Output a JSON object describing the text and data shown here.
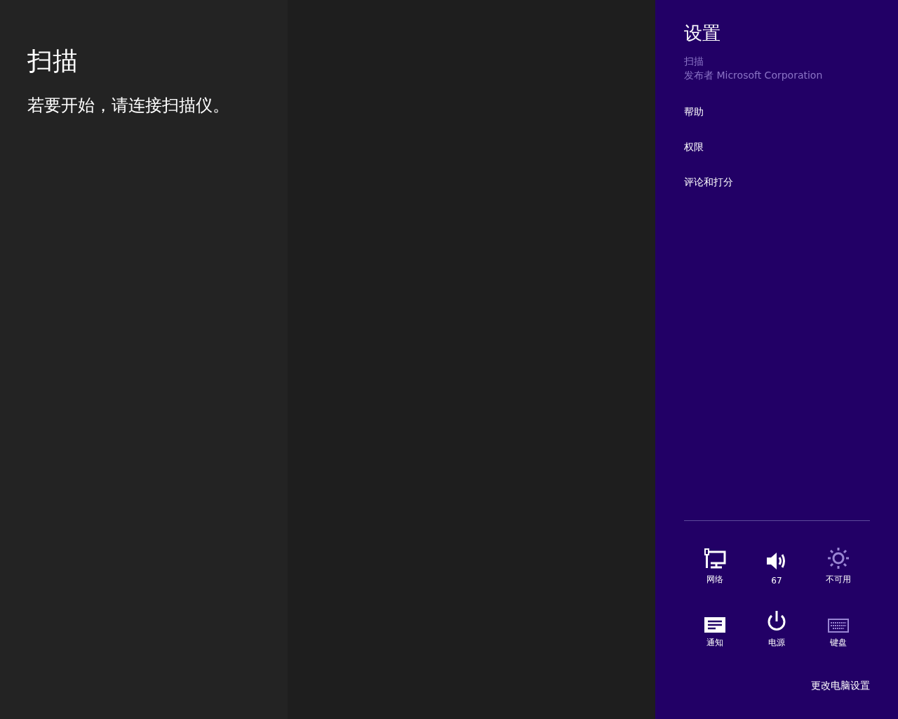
{
  "app": {
    "title": "扫描",
    "message": "若要开始，请连接扫描仪。"
  },
  "settings_pane": {
    "title": "设置",
    "app_name": "扫描",
    "publisher": "发布者 Microsoft Corporation",
    "links": [
      "帮助",
      "权限",
      "评论和打分"
    ],
    "tiles": [
      {
        "kind": "network",
        "label": "网络",
        "disabled": false
      },
      {
        "kind": "volume",
        "label": "67",
        "disabled": false
      },
      {
        "kind": "brightness",
        "label": "不可用",
        "disabled": true
      },
      {
        "kind": "notifications",
        "label": "通知",
        "disabled": false
      },
      {
        "kind": "power",
        "label": "电源",
        "disabled": false
      },
      {
        "kind": "keyboard",
        "label": "键盘",
        "disabled": true
      }
    ],
    "pc_settings_link": "更改电脑设置"
  }
}
